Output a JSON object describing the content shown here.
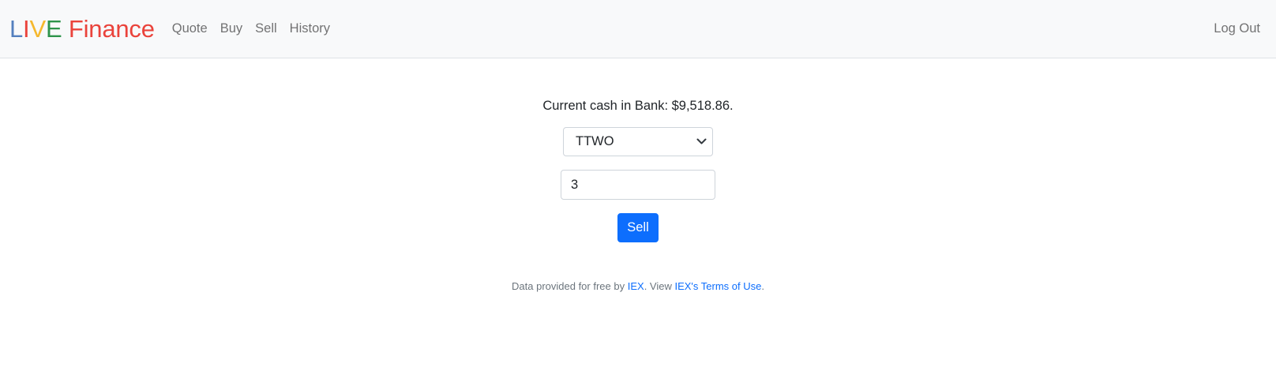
{
  "brand": {
    "letters": [
      {
        "char": "L",
        "color": "#537fbe"
      },
      {
        "char": "I",
        "color": "#ea433b"
      },
      {
        "char": "V",
        "color": "#f5b82e"
      },
      {
        "char": "E",
        "color": "#2e944b"
      },
      {
        "char": " Finance",
        "color": "#ea433b"
      }
    ]
  },
  "nav": {
    "items": [
      {
        "label": "Quote"
      },
      {
        "label": "Buy"
      },
      {
        "label": "Sell"
      },
      {
        "label": "History"
      }
    ],
    "logout_label": "Log Out"
  },
  "main": {
    "cash_text": "Current cash in Bank: $9,518.86.",
    "symbol_selected": "TTWO",
    "shares_value": "3",
    "submit_label": "Sell"
  },
  "footer": {
    "prefix": "Data provided for free by ",
    "iex_link": "IEX",
    "middle": ". View ",
    "terms_link": "IEX's Terms of Use",
    "suffix": "."
  },
  "colors": {
    "primary": "#0d6efd",
    "navbar_bg": "#f8f9fa"
  }
}
